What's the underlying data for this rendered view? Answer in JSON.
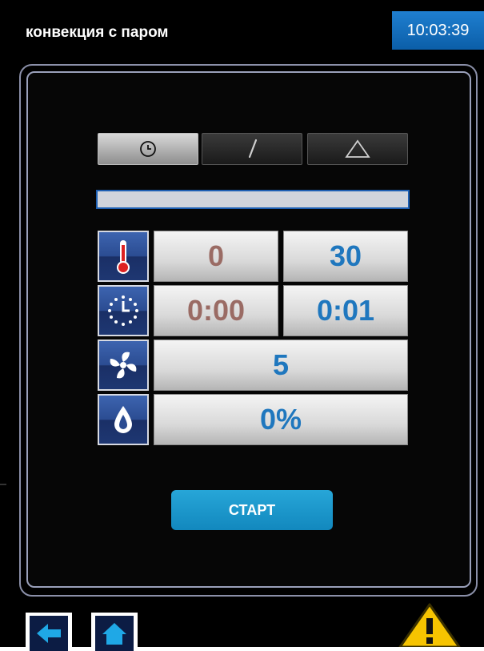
{
  "header": {
    "mode_title": "конвекция с паром",
    "clock": "10:03:39"
  },
  "tabs": [
    {
      "icon": "clock-icon",
      "active": true
    },
    {
      "icon": "probe-icon",
      "active": false
    },
    {
      "icon": "triangle-icon",
      "active": false
    }
  ],
  "progress": {
    "value": 0
  },
  "temperature": {
    "actual": "0",
    "target": "30"
  },
  "time": {
    "actual": "0:00",
    "target": "0:01"
  },
  "fan": {
    "value": "5"
  },
  "humidity": {
    "value": "0%"
  },
  "start_button": {
    "label": "СТАРТ"
  },
  "colors": {
    "accent": "#1288be",
    "actual_value": "#9a6b64",
    "target_value": "#1f77be",
    "clock_bg": "#0b5ea8",
    "warning": "#f6c400"
  },
  "footer": {
    "icons": [
      "back-arrow-icon",
      "home-icon",
      "warning-icon"
    ]
  }
}
